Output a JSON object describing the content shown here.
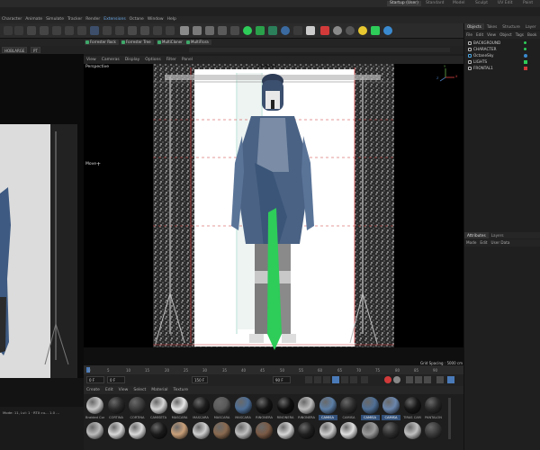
{
  "window": {
    "tabs": [
      "Startup (User)",
      "Standard",
      "Model",
      "Sculpt",
      "UV Edit",
      "Paint"
    ],
    "active_tab_index": 0
  },
  "menubar": [
    "Character",
    "Animate",
    "Simulate",
    "Tracker",
    "Render",
    "Extensions",
    "Octane",
    "Window",
    "Help"
  ],
  "menubar_highlight": "Extensions",
  "subtabs": [
    "Forrester Rock",
    "Forrester Tree",
    "MultiCloner",
    "MultiFlora"
  ],
  "render_settings": {
    "camera_value": "HOBLARGE",
    "frame_value": "PT"
  },
  "viewport": {
    "menu": [
      "View",
      "Cameras",
      "Display",
      "Options",
      "Filter",
      "Panel"
    ],
    "view_name": "Perspective",
    "camera_label": "FRONTAL1",
    "move_label": "Move",
    "grid_spacing": "Grid Spacing : 5000 cm",
    "axis_labels": [
      "Y",
      "Z",
      "X"
    ]
  },
  "timeline": {
    "ticks": [
      "0",
      "5",
      "10",
      "15",
      "20",
      "25",
      "30",
      "35",
      "40",
      "45",
      "50",
      "55",
      "60",
      "65",
      "70",
      "75",
      "80",
      "85",
      "90"
    ],
    "start_frame": "0 F",
    "current_frame": "0 F",
    "end_frame": "90 F",
    "end_frame2": "150 F",
    "left_marker": "8"
  },
  "material_manager": {
    "menu": [
      "Create",
      "Edit",
      "View",
      "Select",
      "Material",
      "Texture"
    ],
    "row1": [
      {
        "name": "Braided Cor",
        "color": "#c8c8c8",
        "selected": false
      },
      {
        "name": "CORTINA",
        "color": "#2a2a2a",
        "selected": false
      },
      {
        "name": "CORTINA",
        "color": "#3b3b3b",
        "selected": false
      },
      {
        "name": "CAMISETA",
        "color": "#d5d5d5",
        "selected": false
      },
      {
        "name": "MASCARA",
        "color": "#e6e6e6",
        "selected": false
      },
      {
        "name": "MASCARA",
        "color": "#1c1c1c",
        "selected": false
      },
      {
        "name": "MASCARA",
        "color": "#5a5a5a",
        "selected": false
      },
      {
        "name": "MASCARA",
        "color": "#4d6e96",
        "selected": false
      },
      {
        "name": "RINONERA",
        "color": "#141414",
        "selected": false
      },
      {
        "name": "RINONERA",
        "color": "#0f0f0f",
        "selected": false
      },
      {
        "name": "RINONERA",
        "color": "#bdbdbd",
        "selected": false
      },
      {
        "name": "CAMISA",
        "color": "#5d7fa6",
        "selected": true
      },
      {
        "name": "CAMISA",
        "color": "#2c2c2c",
        "selected": false
      },
      {
        "name": "CAMISA",
        "color": "#4f6f95",
        "selected": true
      },
      {
        "name": "CAMISA",
        "color": "#6a86ad",
        "selected": true
      },
      {
        "name": "TIRAS CAM",
        "color": "#171717",
        "selected": false
      },
      {
        "name": "PANTALON",
        "color": "#2a2a2a",
        "selected": false
      }
    ],
    "row2_colors": [
      "#bcbcbc",
      "#d8d8d8",
      "#dadada",
      "#1a1a1a",
      "#c9a07a",
      "#cfcfcf",
      "#8a6a50",
      "#bfbfbf",
      "#7a5a45",
      "#d6d6d6",
      "#1f1f1f",
      "#cdcdcd",
      "#e0e0e0",
      "#9a9a9a",
      "#2d2d2d",
      "#c0c0c0",
      "#3a3a3a"
    ]
  },
  "status": {
    "text": "Mode: 11, Lvl: 1 · RTX cu… 1.0 …"
  },
  "objects_panel": {
    "tabs": [
      "Objects",
      "Takes",
      "Structure",
      "Layer"
    ],
    "menu": [
      "File",
      "Edit",
      "View",
      "Object",
      "Tags",
      "Book"
    ],
    "items": [
      {
        "name": "BACKGROUND",
        "icon_color": "#cfcfcf"
      },
      {
        "name": "CHARACTER",
        "icon_color": "#cfcfcf"
      },
      {
        "name": "OctaneSky",
        "icon_color": "#4aa3e0"
      },
      {
        "name": "LIGHTS",
        "icon_color": "#cfcfcf"
      },
      {
        "name": "FRONTAL1",
        "icon_color": "#cfcfcf"
      }
    ]
  },
  "attributes_panel": {
    "tabs": [
      "Attributes",
      "Layers"
    ],
    "menu": [
      "Mode",
      "Edit",
      "User Data"
    ]
  },
  "colors": {
    "accent": "#4a7ab8",
    "render_green": "#2ecc59",
    "record_red": "#d23a3a"
  }
}
